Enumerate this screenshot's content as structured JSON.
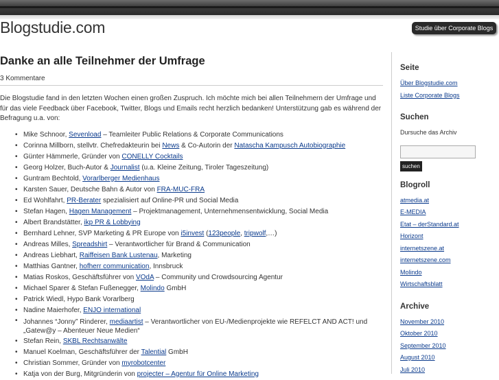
{
  "header": {
    "site_title": "Blogstudie.com",
    "tagline": "Studie über Corporate Blogs"
  },
  "post": {
    "title": "Danke an alle Teilnehmer der Umfrage",
    "comments": "3 Kommentare",
    "intro": "Die Blogstudie fand in den letzten Wochen einen großen Zuspruch. Ich möchte mich bei allen Teilnehmern der Umfrage und für das viele Feedback über Facebook, Twitter, Blogs und Emails recht herzlich bedanken! Unterstützung gab es während der Befragung u.a. von:",
    "people": [
      {
        "before": "Mike Schnoor, ",
        "link": "Sevenload",
        "after": " – Teamleiter Public Relations & Corporate Communications"
      },
      {
        "before": " Corinna Millborn, stellvtr.  Chefredakteurin bei ",
        "link": "News",
        "after": " & Co-Autorin der ",
        "link2": "Natascha Kampusch Autobiographie",
        "after2": ""
      },
      {
        "before": "Günter Hämmerle, Gründer von ",
        "link": "CONELLY Cocktails",
        "after": ""
      },
      {
        "before": "Georg Holzer, Buch-Autor & ",
        "link": "Journalist",
        "after": " (u.a. Kleine Zeitung, Tiroler Tageszeitung)"
      },
      {
        "before": "Guntram Bechtold, ",
        "link": "Vorarlberger Medienhaus",
        "after": ""
      },
      {
        "before": " Karsten Sauer, Deutsche Bahn & Autor von ",
        "link": "FRA-MUC-FRA",
        "after": ""
      },
      {
        "before": "Ed Wohlfahrt, ",
        "link": " PR-Berater",
        "after": " spezialisiert auf Online-PR und Social Media"
      },
      {
        "before": "Stefan Hagen, ",
        "link": "Hagen Management",
        "after": " – Projektmanagement, Unternehmensentwicklung, Social Media"
      },
      {
        "before": " Albert Brandstätter, ",
        "link": "ikp PR & Lobbying",
        "after": ""
      },
      {
        "before": "Bernhard Lehner, SVP Marketing & PR Europe von ",
        "link": "i5invest",
        "after": " (",
        "link2": "123people",
        "after2": ", ",
        "link3": "tripwolf",
        "after3": ",…)"
      },
      {
        "before": "Andreas Milles, ",
        "link": "Spreadshirt",
        "after": " – Verantwortlicher für Brand & Communication"
      },
      {
        "before": "Andreas Liebhart, ",
        "link": "Raiffeisen Bank Lustenau",
        "after": ", Marketing"
      },
      {
        "before": " Matthias Gantner, ",
        "link": "hofherr communication",
        "after": ", Innsbruck"
      },
      {
        "before": "Matias Roskos, Geschäftsführer von ",
        "link": "VOdA",
        "after": " – Community und Crowdsourcing Agentur"
      },
      {
        "before": " Michael Sparer & Stefan Fußenegger, ",
        "link": "Molindo",
        "after": " GmbH"
      },
      {
        "before": "Patrick Wiedl, Hypo Bank Vorarlberg",
        "link": "",
        "after": ""
      },
      {
        "before": "Nadine Maierhofer, ",
        "link": "ENJO international",
        "after": ""
      },
      {
        "before": "Johannes “Jonny” Rinderer, ",
        "link": "mediaartist",
        "after": " – Verantwortlicher von EU-/Medienprojekte wie REFELCT AND ACT! und „Gatew@y – Abenteuer Neue Medien“",
        "wrap": true
      },
      {
        "before": "Stefan Rein, ",
        "link": "SKBL Rechtsanwälte",
        "after": ""
      },
      {
        "before": "Manuel Koelman, Geschäftsführer der ",
        "link": "Talential",
        "after": " GmbH"
      },
      {
        "before": "Christian Sommer, Gründer von ",
        "link": "myrobotcenter",
        "after": ""
      },
      {
        "before": "Katja von der Burg, Mitgründerin von ",
        "link": "projecter – Agentur für Online Marketing",
        "after": ""
      }
    ]
  },
  "sidebar": {
    "seite": {
      "title": "Seite",
      "items": [
        "Über Blogstudie.com",
        "Liste Corporate Blogs"
      ]
    },
    "suchen": {
      "title": "Suchen",
      "label": "Dursuche das Archiv",
      "button": "suchen",
      "value": ""
    },
    "blogroll": {
      "title": "Blogroll",
      "items": [
        "atmedia.at",
        "E-MEDIA",
        "Etat – derStandard.at",
        "Horizont",
        "internetszene.at",
        "internetszene.com",
        "Molindo",
        "Wirtschaftsblatt"
      ]
    },
    "archive": {
      "title": "Archive",
      "items": [
        "November 2010",
        "Oktober 2010",
        "September 2010",
        "August 2010",
        "Juli 2010"
      ]
    }
  }
}
